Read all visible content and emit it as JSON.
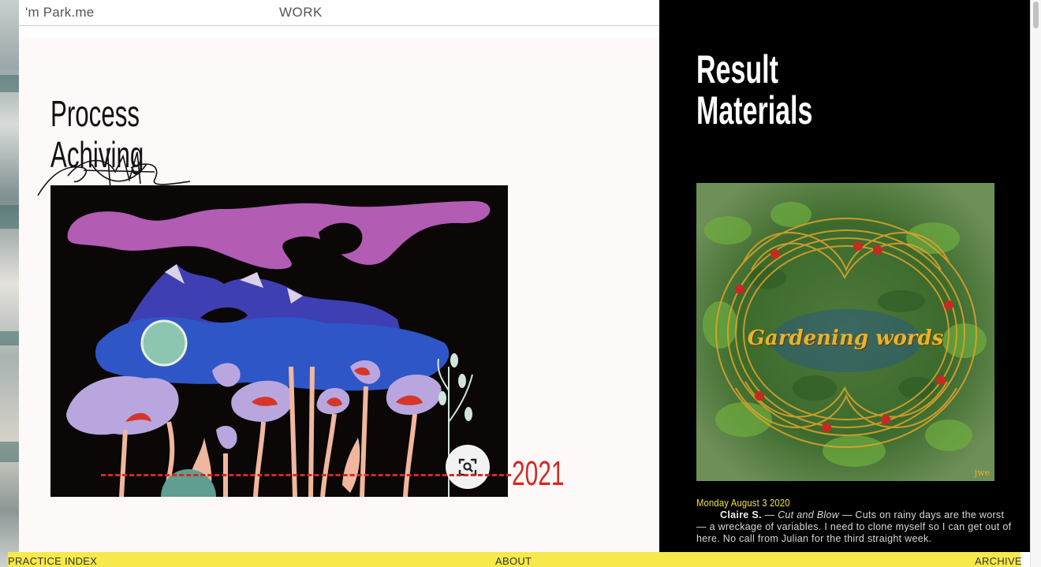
{
  "nav": {
    "brand": "'m Park.me",
    "work_label": "WORK"
  },
  "left": {
    "heading_line1": "Process",
    "heading_line2": "Achiving",
    "year": "2021",
    "lens_icon": "lens-search-icon"
  },
  "right": {
    "heading_line1": "Result",
    "heading_line2": "Materials",
    "image": {
      "title": "Gardening words",
      "signature": "jwe"
    },
    "post": {
      "date": "Monday August 3 2020",
      "author": "Claire S.",
      "title": "Cut and Blow",
      "text": "Cuts on rainy days are the worst — a wreckage of variables. I need to clone myself so I can get out of here. No call from Julian for the third straight week."
    }
  },
  "footer": {
    "practice": "PRACTICE",
    "index": "INDEX",
    "about": "ABOUT",
    "archive": "ARCHIVE"
  },
  "colors": {
    "accent_red": "#d42a22",
    "footer_yellow": "#f7e94c",
    "date_yellow": "#f3e346",
    "panel_black": "#000000"
  }
}
